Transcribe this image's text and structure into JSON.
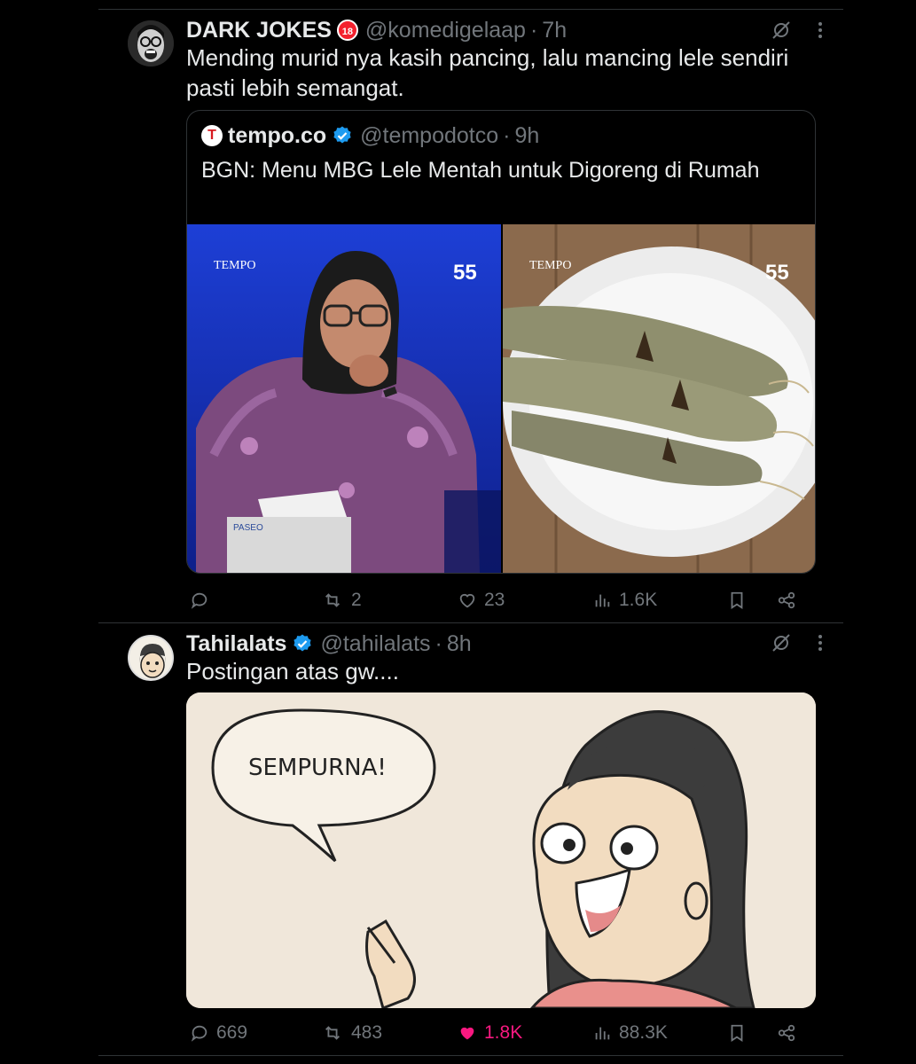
{
  "tweets": [
    {
      "author": "DARK JOKES",
      "badge": "18",
      "handle": "@komedigelaap",
      "separator": "·",
      "time": "7h",
      "text": "Mending murid nya kasih pancing, lalu mancing lele sendiri pasti lebih semangat.",
      "quote": {
        "author": "tempo.co",
        "logo_letter": "T",
        "handle": "@tempodotco",
        "separator": "·",
        "time": "9h",
        "text": "BGN: Menu MBG Lele Mentah untuk Digoreng di Rumah",
        "images": [
          {
            "watermark": "TEMPO",
            "mark": "55",
            "box_label": "PASEO"
          },
          {
            "watermark": "TEMPO",
            "mark": "55"
          }
        ]
      },
      "stats": {
        "replies": "",
        "reposts": "2",
        "likes": "23",
        "views": "1.6K"
      }
    },
    {
      "author": "Tahilalats",
      "handle": "@tahilalats",
      "separator": "·",
      "time": "8h",
      "text": "Postingan atas gw....",
      "comic": {
        "speech": "SEMPURNA!"
      },
      "stats": {
        "replies": "669",
        "reposts": "483",
        "likes": "1.8K",
        "views": "88.3K"
      }
    }
  ],
  "colors": {
    "background": "#000000",
    "text": "#e7e9ea",
    "muted": "#71767b",
    "border": "#2f3336",
    "verified": "#1d9bf0",
    "like_active": "#f91880"
  },
  "icons": [
    "grok-icon",
    "more-icon",
    "reply-icon",
    "repost-icon",
    "like-icon",
    "views-icon",
    "bookmark-icon",
    "share-icon",
    "verified-icon"
  ]
}
